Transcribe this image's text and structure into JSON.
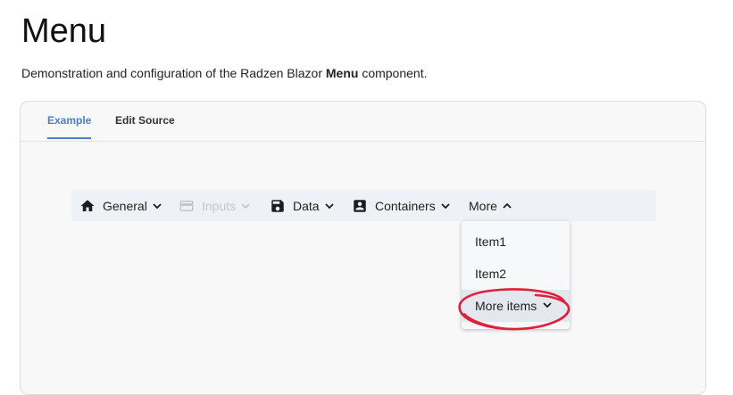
{
  "page": {
    "title": "Menu",
    "description_prefix": "Demonstration and configuration of the Radzen Blazor ",
    "description_bold": "Menu",
    "description_suffix": " component."
  },
  "tabs": [
    {
      "label": "Example",
      "active": true
    },
    {
      "label": "Edit Source",
      "active": false
    }
  ],
  "menu": {
    "items": [
      {
        "label": "General",
        "icon": "home-icon",
        "disabled": false
      },
      {
        "label": "Inputs",
        "icon": "credit-card-icon",
        "disabled": true
      },
      {
        "label": "Data",
        "icon": "save-icon",
        "disabled": false
      },
      {
        "label": "Containers",
        "icon": "account-box-icon",
        "disabled": false
      },
      {
        "label": "More",
        "icon": "",
        "disabled": false,
        "expanded": true
      }
    ],
    "more_submenu": [
      {
        "label": "Item1"
      },
      {
        "label": "Item2"
      },
      {
        "label": "More items",
        "has_children": true,
        "hovered": true
      }
    ]
  },
  "colors": {
    "accent": "#4a7fc9",
    "annotation": "#e0203a"
  }
}
